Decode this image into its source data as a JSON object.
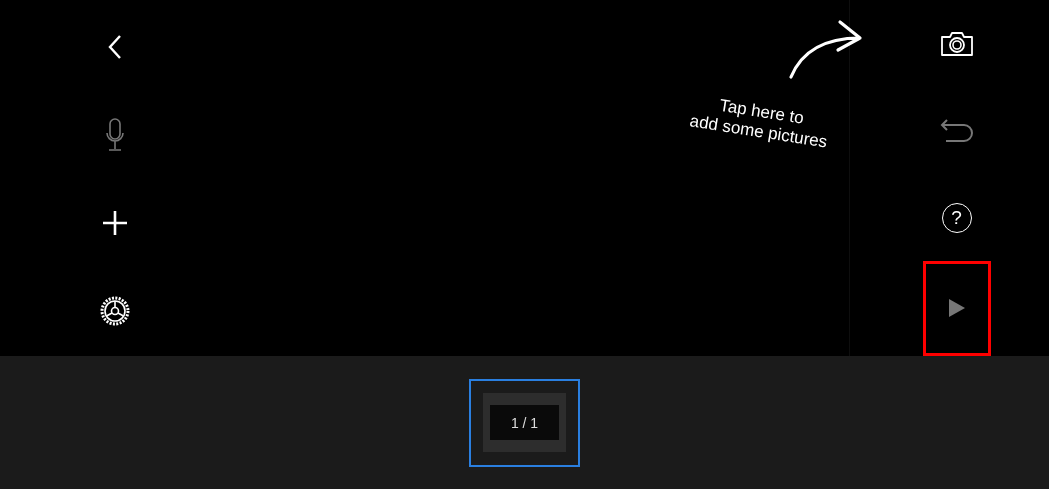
{
  "left_toolbar": [
    {
      "kind": "back",
      "disabled": false
    },
    {
      "kind": "microphone",
      "disabled": true
    },
    {
      "kind": "add",
      "disabled": false
    },
    {
      "kind": "settings",
      "disabled": false
    }
  ],
  "hint": {
    "lines": [
      "Tap here to",
      "add some pictures"
    ]
  },
  "right_toolbar": [
    {
      "kind": "camera",
      "disabled": false,
      "highlighted": false
    },
    {
      "kind": "undo",
      "disabled": true,
      "highlighted": false
    },
    {
      "kind": "help",
      "label": "?",
      "disabled": false,
      "highlighted": false
    },
    {
      "kind": "play",
      "disabled": true,
      "highlighted": true
    }
  ],
  "filmstrip": [
    {
      "label": "1 / 1",
      "selected": true
    }
  ]
}
